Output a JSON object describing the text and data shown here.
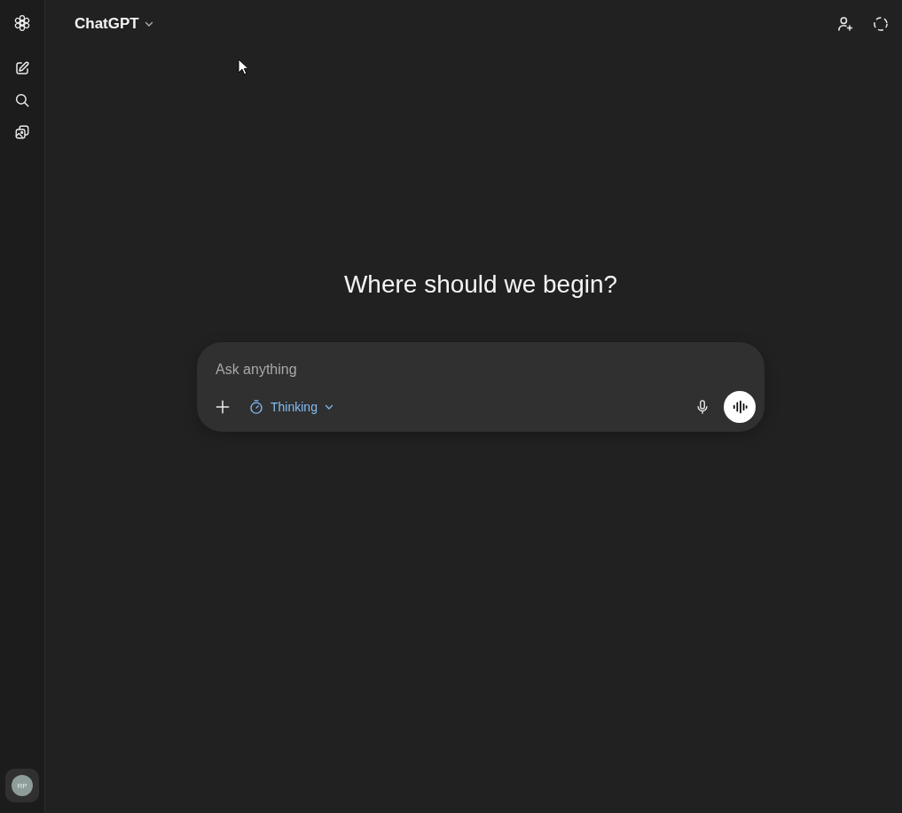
{
  "sidebar": {
    "avatar_initials": "RP"
  },
  "header": {
    "model_name": "ChatGPT"
  },
  "greeting": "Where should we begin?",
  "composer": {
    "placeholder": "Ask anything",
    "mode": "Thinking"
  }
}
